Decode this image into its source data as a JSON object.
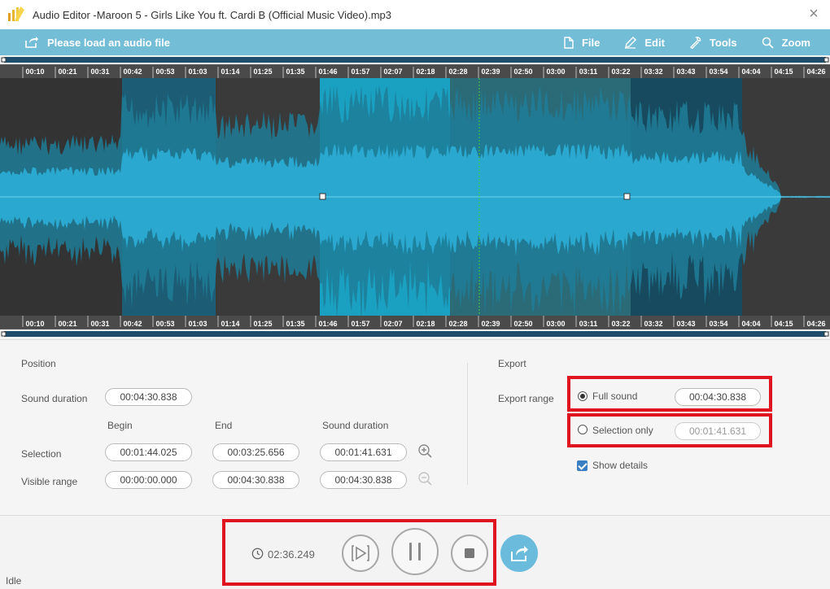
{
  "window": {
    "title": "Audio Editor  -Maroon 5 - Girls Like You ft. Cardi B (Official Music Video).mp3",
    "close_label": "×"
  },
  "toolbar": {
    "load_label": "Please load an audio file",
    "menu": [
      {
        "label": "File",
        "icon": "file-icon"
      },
      {
        "label": "Edit",
        "icon": "pencil-icon"
      },
      {
        "label": "Tools",
        "icon": "wrench-icon"
      },
      {
        "label": "Zoom",
        "icon": "search-icon"
      }
    ]
  },
  "timeline": {
    "ticks": [
      "00:10",
      "00:21",
      "00:31",
      "00:42",
      "00:53",
      "01:03",
      "01:14",
      "01:25",
      "01:35",
      "01:46",
      "01:57",
      "02:07",
      "02:18",
      "02:28",
      "02:39",
      "02:50",
      "03:00",
      "03:11",
      "03:22",
      "03:32",
      "03:43",
      "03:54",
      "04:04",
      "04:15",
      "04:26"
    ],
    "playhead": "02:36.249",
    "selection_begin": "00:01:44.025",
    "selection_end": "00:03:25.656"
  },
  "position": {
    "section_title": "Position",
    "sound_duration_label": "Sound duration",
    "sound_duration_value": "00:04:30.838",
    "col_begin": "Begin",
    "col_end": "End",
    "col_duration": "Sound duration",
    "selection_label": "Selection",
    "selection_begin": "00:01:44.025",
    "selection_end": "00:03:25.656",
    "selection_duration": "00:01:41.631",
    "visible_label": "Visible range",
    "visible_begin": "00:00:00.000",
    "visible_end": "00:04:30.838",
    "visible_duration": "00:04:30.838"
  },
  "export": {
    "section_title": "Export",
    "range_label": "Export range",
    "full_sound_label": "Full sound",
    "full_sound_value": "00:04:30.838",
    "selection_only_label": "Selection only",
    "selection_only_value": "00:01:41.631",
    "show_details_label": "Show details"
  },
  "transport": {
    "current_time": "02:36.249"
  },
  "status": {
    "text": "Idle"
  },
  "colors": {
    "toolbar": "#74bdd6",
    "wave_light": "#2aa8cf",
    "wave_selected": "#1bb6d8",
    "highlight_red": "#e0141f"
  }
}
